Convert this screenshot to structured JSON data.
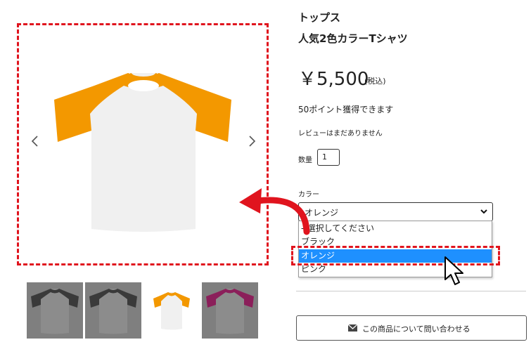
{
  "product": {
    "category": "トップス",
    "name": "人気2色カラーTシャツ",
    "price": "￥5,500",
    "tax_note": "(税込)",
    "points": "50ポイント獲得できます",
    "reviews": "レビューはまだありません",
    "quantity_label": "数量",
    "quantity_value": "1",
    "color_label": "カラー",
    "color_selected": "オレンジ"
  },
  "color_dropdown": {
    "options": [
      "--選択してください",
      "ブラック",
      "オレンジ",
      "ピンク"
    ],
    "highlighted": "オレンジ"
  },
  "contact_button": {
    "label": "この商品について問い合わせる"
  },
  "gallery": {
    "thumbnails": [
      "black",
      "black",
      "orange",
      "pink"
    ]
  },
  "colors": {
    "accent_red": "#e0141e",
    "orange": "#f39800",
    "body_white": "#f0f0f0",
    "highlight_blue": "#1e90ff",
    "black_sleeve": "#3a3a3a",
    "pink_sleeve": "#8b1f5a"
  },
  "icons": {
    "prev": "chevron-left-icon",
    "next": "chevron-right-icon",
    "mail": "envelope-icon",
    "select": "chevron-down-icon",
    "cursor": "mouse-cursor-icon",
    "annotation": "curved-arrow-icon"
  }
}
